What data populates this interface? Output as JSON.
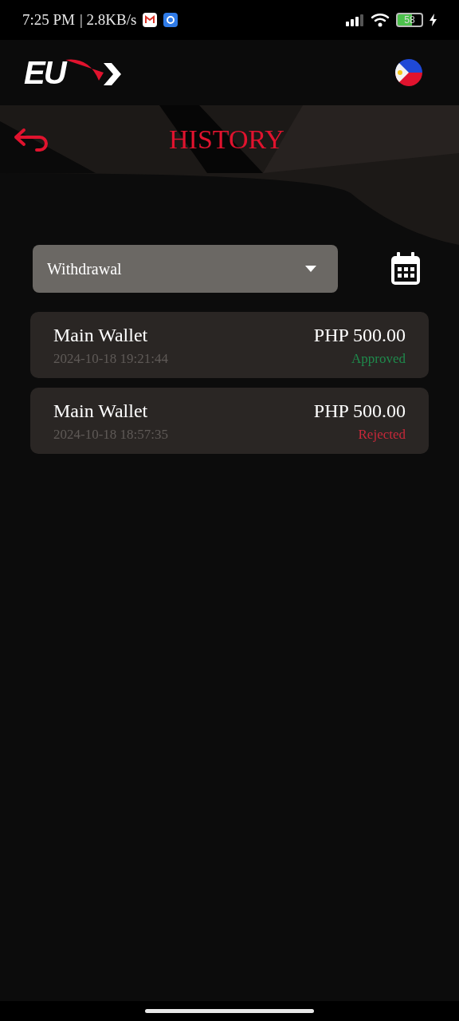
{
  "status_bar": {
    "time": "7:25 PM",
    "speed": "| 2.8KB/s",
    "battery": "58"
  },
  "app_bar": {
    "logo": "EU"
  },
  "page": {
    "title": "HISTORY"
  },
  "filter": {
    "value": "Withdrawal"
  },
  "transactions": [
    {
      "wallet": "Main Wallet",
      "amount": "PHP 500.00",
      "time": "2024-10-18 19:21:44",
      "status": "Approved",
      "kind": "approved"
    },
    {
      "wallet": "Main Wallet",
      "amount": "PHP 500.00",
      "time": "2024-10-18 18:57:35",
      "status": "Rejected",
      "kind": "rejected"
    }
  ]
}
